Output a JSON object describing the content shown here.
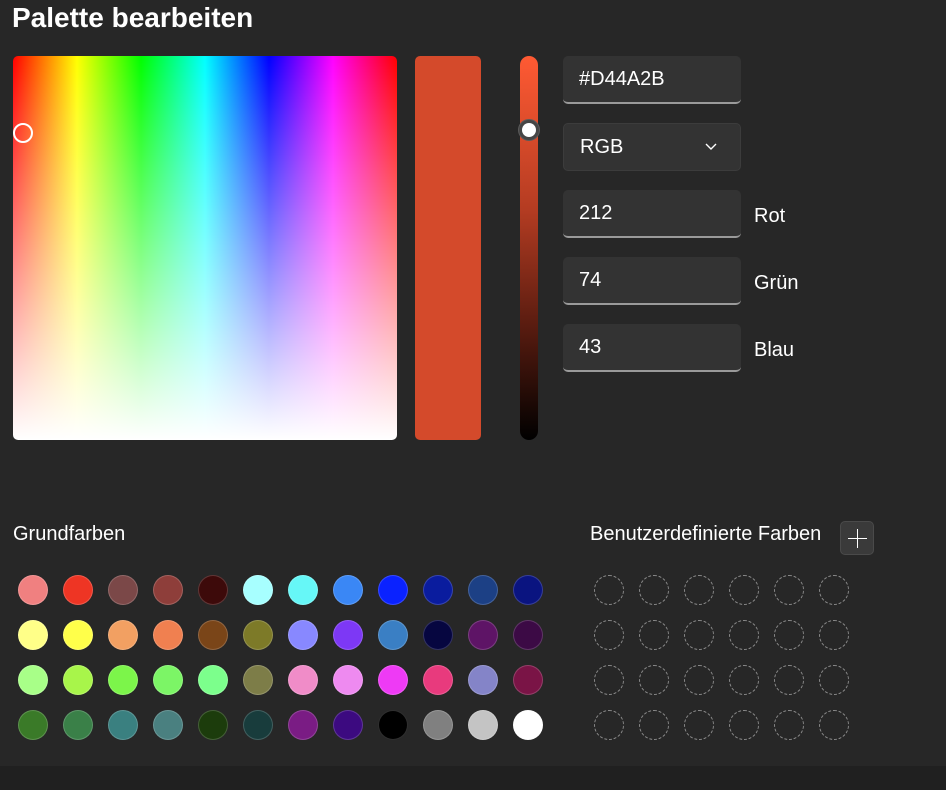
{
  "title": "Palette bearbeiten",
  "color": {
    "hex": "#D44A2B",
    "model": "RGB",
    "red": "212",
    "green": "74",
    "blue": "43",
    "red_label": "Rot",
    "green_label": "Grün",
    "blue_label": "Blau"
  },
  "basic_colors": {
    "label": "Grundfarben",
    "rows": [
      [
        "#F08080",
        "#EE3524",
        "#7B4848",
        "#8E3E3A",
        "#3D0A0A",
        "#A7FFFF",
        "#66F7F7",
        "#3A87F5",
        "#0A22FF",
        "#0A1C9E",
        "#1C4085",
        "#0A1480"
      ],
      [
        "#FFFF88",
        "#FFFF4A",
        "#F2A062",
        "#F08050",
        "#7A4518",
        "#7D7A28",
        "#8888FF",
        "#7D38F5",
        "#3A7FC4",
        "#060640",
        "#5E1466",
        "#3C0A45"
      ],
      [
        "#A8FF88",
        "#A8F54A",
        "#7CF54A",
        "#7CF566",
        "#7CFF8C",
        "#7D7D48",
        "#F08CC8",
        "#EE8AF0",
        "#EE3AF5",
        "#E83A7D",
        "#8484C8",
        "#7A1446"
      ],
      [
        "#3A7A28",
        "#3A8048",
        "#3A8080",
        "#4A8080",
        "#1C3C0C",
        "#183C3C",
        "#7A1C84",
        "#3C0A80",
        "#000000",
        "#808080",
        "#C4C4C4",
        "#FFFFFF"
      ]
    ]
  },
  "custom_colors": {
    "label": "Benutzerdefinierte Farben"
  },
  "icons": {
    "dropdown": "chevron-down-icon",
    "add": "plus-icon"
  }
}
